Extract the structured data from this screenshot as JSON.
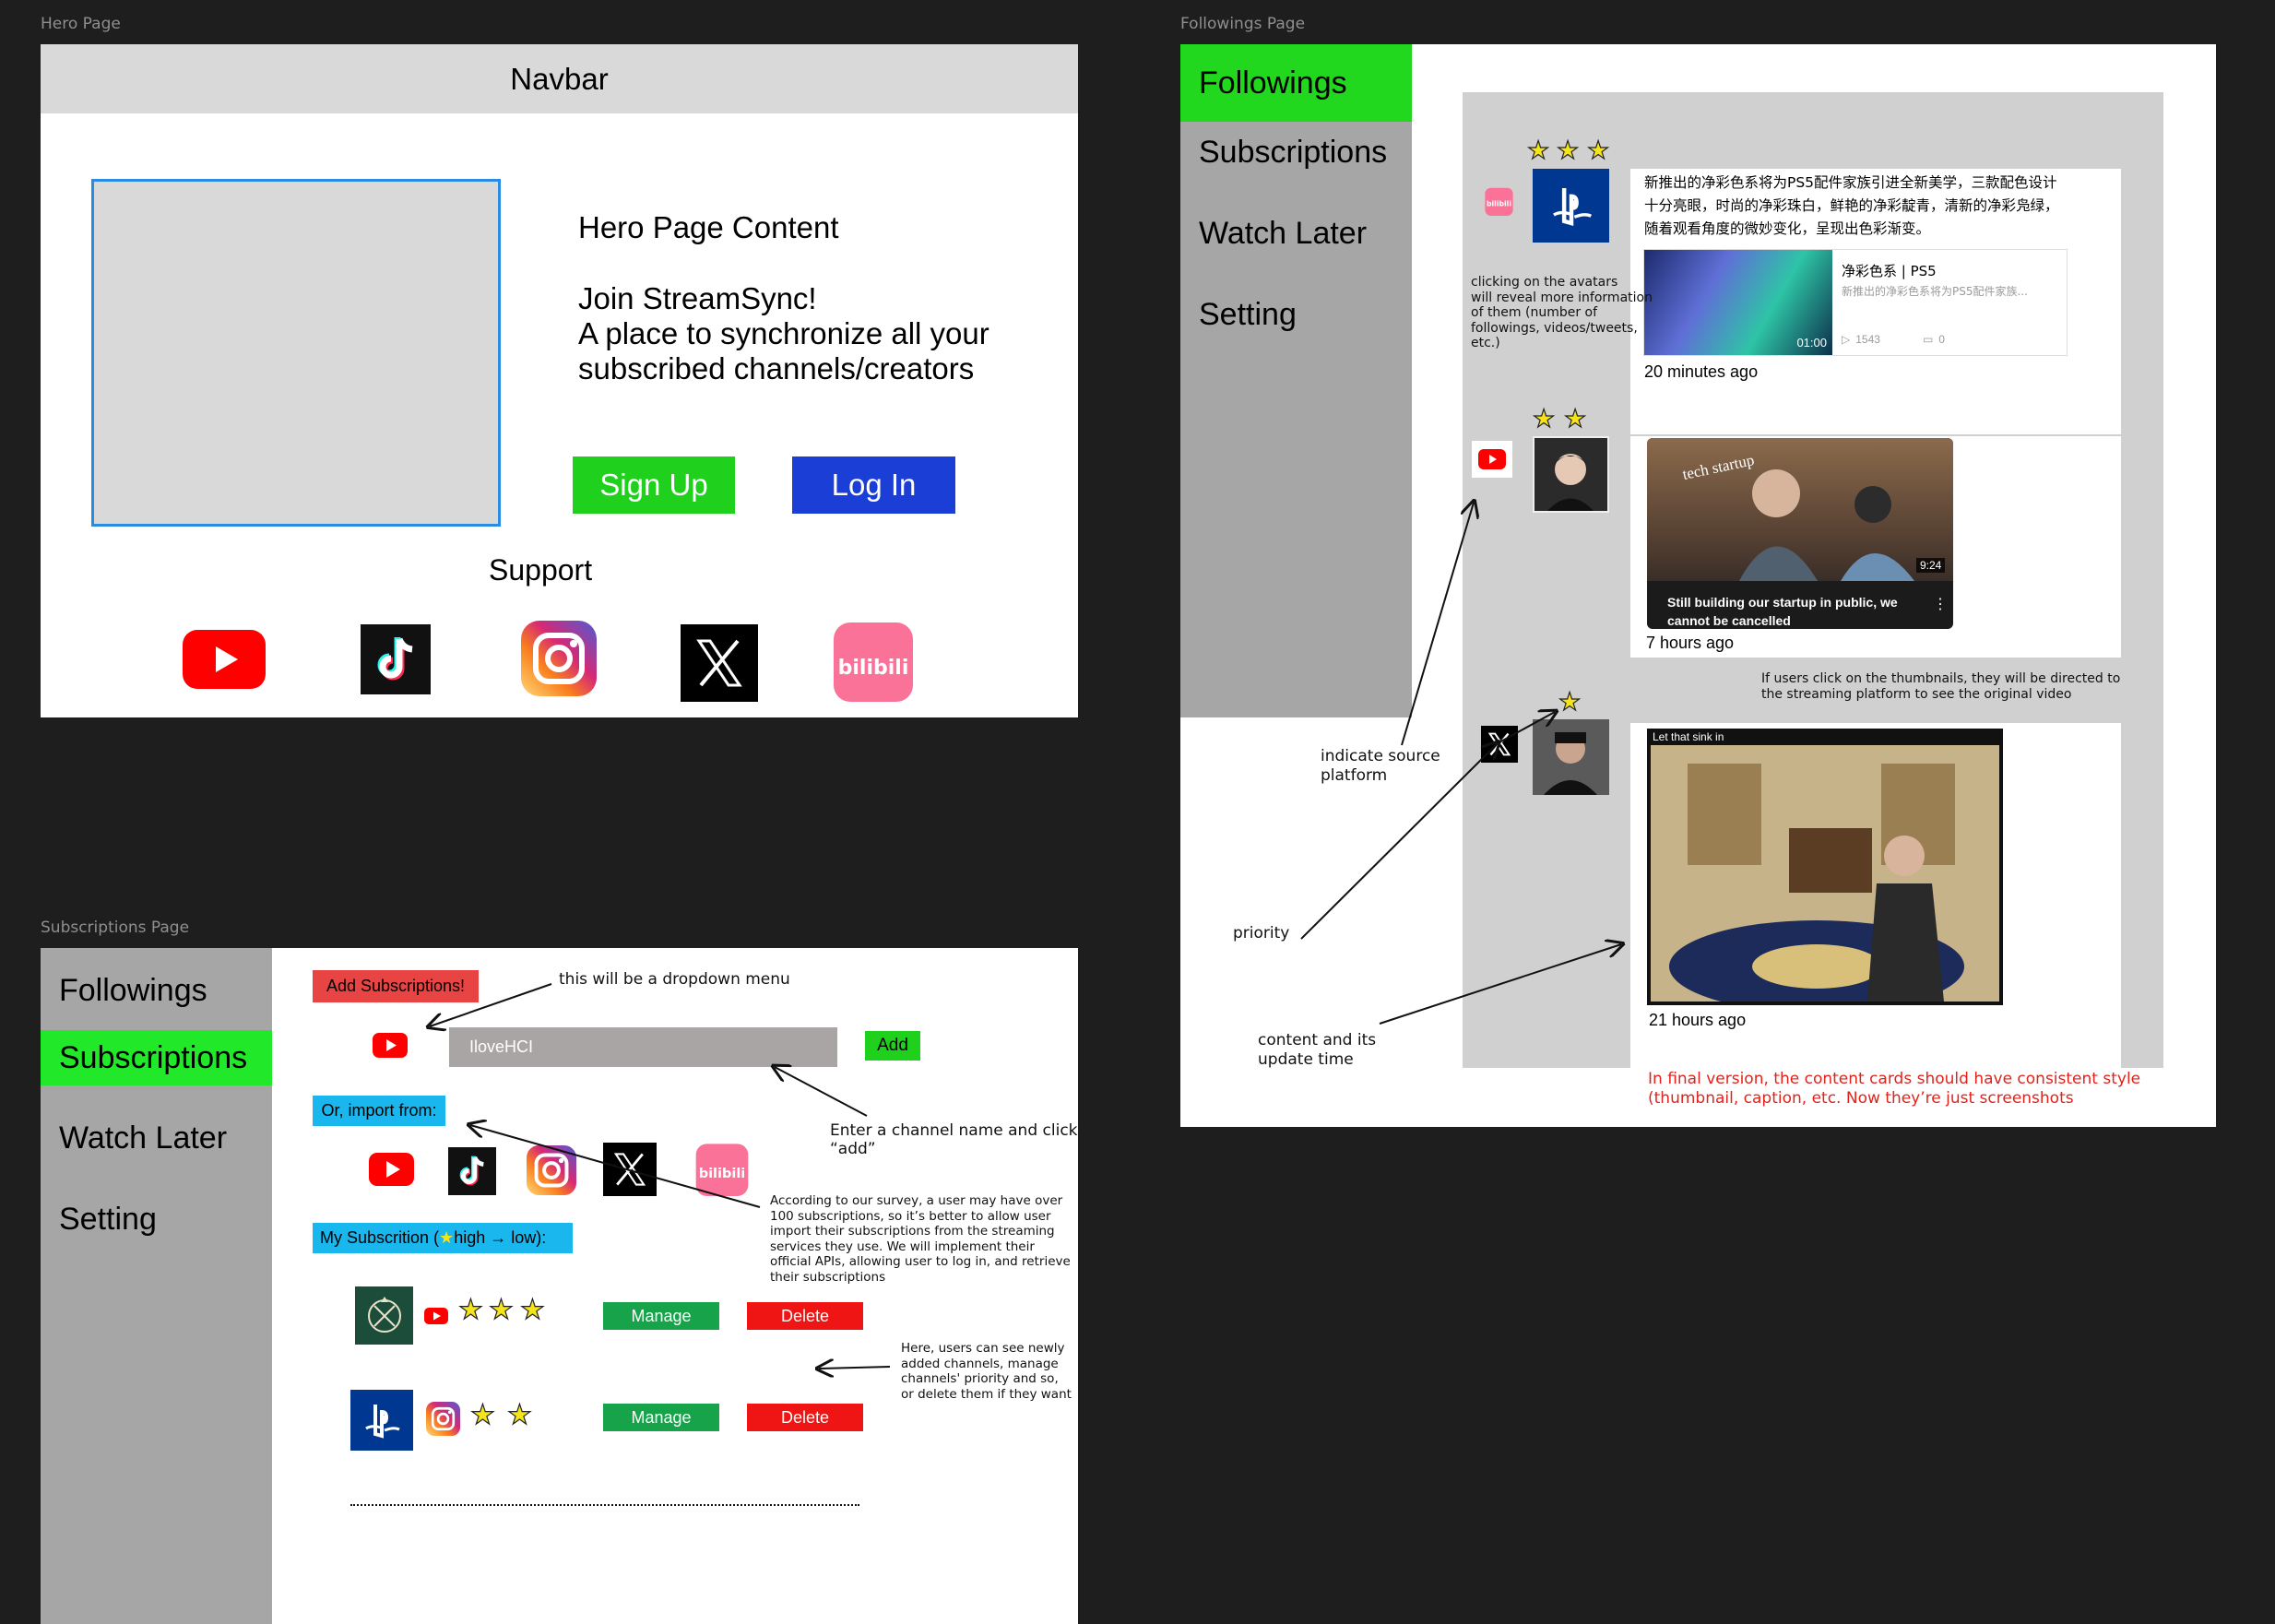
{
  "hero": {
    "frame_label": "Hero Page",
    "navbar": "Navbar",
    "content_title": "Hero Page Content",
    "content_body": "Join StreamSync!\nA place to synchronize all your\nsubscribed channels/creators",
    "signup_label": "Sign Up",
    "login_label": "Log In",
    "support_label": "Support",
    "platform_icons": [
      "youtube-icon",
      "tiktok-icon",
      "instagram-icon",
      "x-icon",
      "bilibili-icon"
    ]
  },
  "subscriptions": {
    "frame_label": "Subscriptions Page",
    "nav": [
      "Followings",
      "Subscriptions",
      "Watch Later",
      "Setting"
    ],
    "active_nav": "Subscriptions",
    "add_header": "Add Subscriptions!",
    "channel_input_value": "IloveHCI",
    "add_label": "Add",
    "import_header": "Or, import from:",
    "my_sub_prefix": "My Subscrition (",
    "my_sub_suffix": "high → low):",
    "rows": [
      {
        "avatar": "crest-icon",
        "platform": "youtube-icon",
        "stars": 3,
        "manage": "Manage",
        "delete": "Delete"
      },
      {
        "avatar": "playstation-icon",
        "platform": "instagram-icon",
        "stars": 2,
        "manage": "Manage",
        "delete": "Delete"
      }
    ],
    "notes": {
      "dropdown": "this will be a dropdown menu",
      "enter_channel": "Enter a channel name and click\n“add”",
      "survey": "According to our survey, a user may have over\n100 subscriptions, so it’s better to allow user\nimport their subscriptions from the streaming\nservices they use. We will implement their\nofficial APIs, allowing user to log in, and retrieve\ntheir subscriptions",
      "manage_note": "Here, users can see newly\nadded channels, manage\nchannels' priority and so,\nor delete them if they want"
    }
  },
  "followings": {
    "frame_label": "Followings Page",
    "nav": [
      "Followings",
      "Subscriptions",
      "Watch Later",
      "Setting"
    ],
    "active_nav": "Followings",
    "cards": [
      {
        "platform": "bilibili-icon",
        "avatar": "playstation-icon",
        "stars": 3,
        "text": "新推出的净彩色系将为PS5配件家族引进全新美学，三款配色设计\n十分亮眼，时尚的净彩珠白，鲜艳的净彩靛青，清新的净彩凫绿，\n随着观看角度的微妙变化，呈现出色彩渐变。",
        "video_title": "净彩色系 | PS5",
        "video_desc": "新推出的净彩色系将为PS5配件家族...",
        "duration": "01:00",
        "views": "1543",
        "comments": "0",
        "time": "20 minutes ago"
      },
      {
        "platform": "youtube-icon",
        "avatar": "creator-avatar",
        "stars": 2,
        "thumb_overlay": "tech startup",
        "duration": "9:24",
        "caption": "Still building our startup in public, we\ncannot be cancelled",
        "time": "7 hours ago"
      },
      {
        "platform": "x-icon",
        "avatar": "creator-avatar",
        "stars": 1,
        "thumb_caption": "Let that sink in",
        "time": "21 hours ago"
      }
    ],
    "notes": {
      "avatars": "clicking on the avatars\nwill reveal more information\nof them (number of\nfollowings, videos/tweets,\n etc.)",
      "thumbnails": "If users click on the thumbnails, they will be directed to\nthe streaming platform to see the original video",
      "source": "indicate source\nplatform",
      "priority": "priority",
      "content": "content and its\nupdate time",
      "final": "In final version, the content cards should have consistent style\n(thumbnail, caption, etc. Now they’re just screenshots"
    },
    "colors": {
      "note_red": "#e0241d",
      "active_green": "#22d81f"
    }
  }
}
